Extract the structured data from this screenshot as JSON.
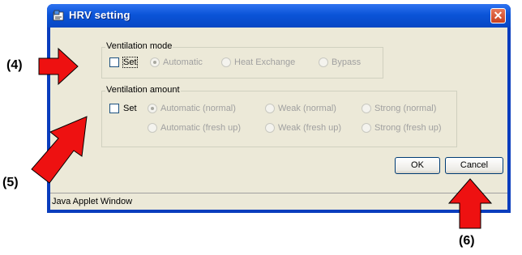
{
  "window": {
    "title": "HRV setting",
    "close_glyph": "✕"
  },
  "ventilation_mode": {
    "legend": "Ventilation mode",
    "set_label": "Set",
    "options": [
      "Automatic",
      "Heat Exchange",
      "Bypass"
    ],
    "selected": "Automatic"
  },
  "ventilation_amount": {
    "legend": "Ventilation amount",
    "set_label": "Set",
    "options_row1": [
      "Automatic (normal)",
      "Weak (normal)",
      "Strong (normal)"
    ],
    "options_row2": [
      "Automatic (fresh up)",
      "Weak (fresh up)",
      "Strong (fresh up)"
    ],
    "selected": "Automatic (normal)"
  },
  "buttons": {
    "ok": "OK",
    "cancel": "Cancel"
  },
  "status_bar": "Java Applet Window",
  "callouts": {
    "c4": "(4)",
    "c5": "(5)",
    "c6": "(6)"
  },
  "colors": {
    "arrow_fill": "#ee1111",
    "arrow_stroke": "#000000",
    "titlebar": "#0b54d8"
  }
}
